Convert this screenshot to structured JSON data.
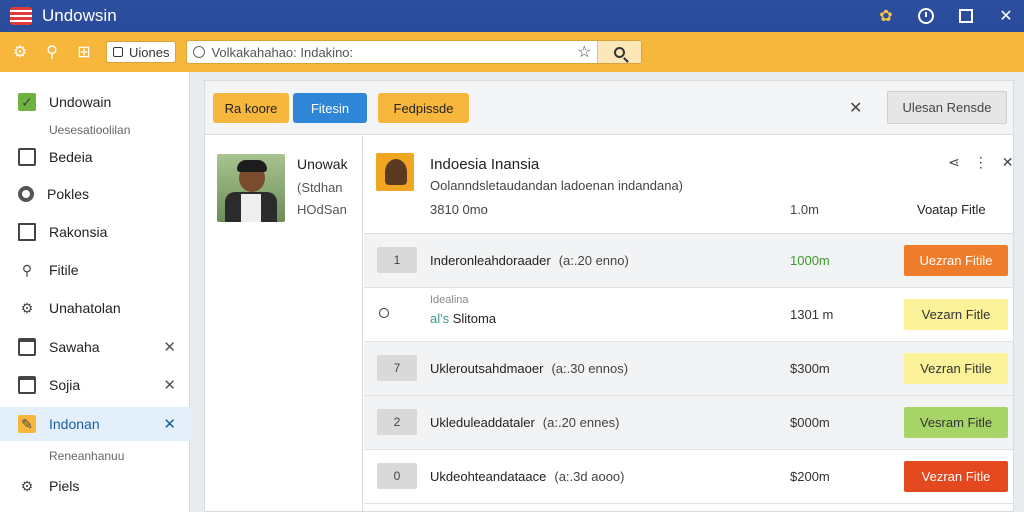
{
  "window": {
    "title": "Undowsin",
    "controls": [
      "extension-icon",
      "clock-icon",
      "maximize-icon",
      "close-icon"
    ]
  },
  "toolbar": {
    "tab_label": "Uiones",
    "address": "Volkakahahao: Indakino:",
    "icons": [
      "gear-icon",
      "pin-icon",
      "grid-icon",
      "star-icon",
      "search-icon"
    ]
  },
  "sidebar": {
    "items": [
      {
        "label": "Undowain",
        "icon": "check-icon"
      },
      {
        "label": "Bedeia",
        "icon": "grid-icon"
      },
      {
        "label": "Pokles",
        "icon": "circle-icon"
      },
      {
        "label": "Rakonsia",
        "icon": "document-icon"
      },
      {
        "label": "Fitile",
        "icon": "pin-icon"
      },
      {
        "label": "Unahatolan",
        "icon": "gear-icon"
      },
      {
        "label": "Sawaha",
        "icon": "card-icon"
      },
      {
        "label": "Sojia",
        "icon": "card-icon"
      },
      {
        "label": "Indonan",
        "icon": "edit-icon"
      },
      {
        "label": "Piels",
        "icon": "gear-icon"
      }
    ],
    "sub_label_1": "Uesesatioolilan",
    "sub_label_2": "Reneanhanuu",
    "close_glyph": "✕"
  },
  "actions": {
    "btn1": "Ra koore",
    "btn2": "Fitesin",
    "btn3": "Fedpissde",
    "save": "Ulesan Rensde",
    "close_glyph": "✕"
  },
  "contact": {
    "name": "Unowak",
    "line2": "(Stdhan",
    "line3": "HOdSan"
  },
  "details": {
    "title": "Indoesia Inansia",
    "subtitle": "Oolanndsletaudandan ladoenan indandana)",
    "meta1": "3810 0mo",
    "meta2": "1.0m",
    "meta3": "Voatap Fitle",
    "icons": [
      "share-icon",
      "more-icon",
      "close-icon"
    ]
  },
  "rows": [
    {
      "num": "1",
      "desc": "Inderonleahdoraader",
      "paren": "(a:.20 enno)",
      "amount": "1000m",
      "amount_color": "#3a9a2a",
      "button": "Uezran Fitile",
      "btn_bg": "#ee7d2b",
      "btn_fg": "#ffffff",
      "shaded": true
    },
    {
      "num": "",
      "small_top": "Idealina",
      "small_lead": "al's",
      "small_rest": " Slitoma",
      "amount": "1301 m",
      "button": "Vezarn Fitle",
      "btn_bg": "#fbf29a",
      "btn_fg": "#333333",
      "shaded": false
    },
    {
      "num": "7",
      "desc": "Ukleroutsahdmaoer",
      "paren": "(a:.30 ennos)",
      "amount": "$300m",
      "button": "Vezran Fitile",
      "btn_bg": "#fbf29a",
      "btn_fg": "#333333",
      "shaded": true
    },
    {
      "num": "2",
      "desc": "Ukleduleaddataler",
      "paren": "(a:.20 ennes)",
      "amount": "$000m",
      "button": "Vesram Fitle",
      "btn_bg": "#a7d467",
      "btn_fg": "#333333",
      "shaded": true
    },
    {
      "num": "0",
      "desc": "Ukdeohteandataace",
      "paren": "(a:.3d aooo)",
      "amount": "$200m",
      "button": "Vezran Fitle",
      "btn_bg": "#e4481f",
      "btn_fg": "#ffffff",
      "shaded": false
    }
  ]
}
